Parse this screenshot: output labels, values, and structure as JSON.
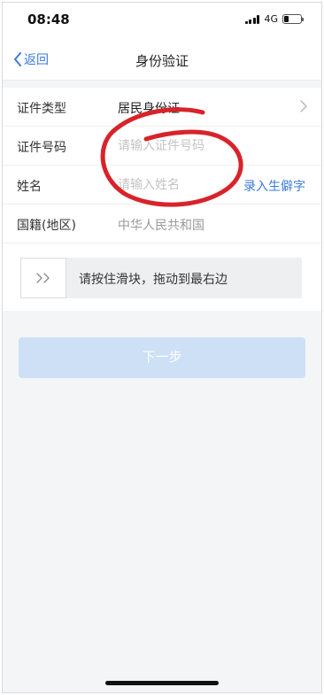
{
  "status_bar": {
    "time": "08:48",
    "network": "4G",
    "battery_level": 0.3
  },
  "nav": {
    "back_label": "返回",
    "title": "身份验证"
  },
  "form": {
    "rows": [
      {
        "label": "证件类型",
        "value": "居民身份证"
      },
      {
        "label": "证件号码",
        "placeholder": "请输入证件号码"
      },
      {
        "label": "姓名",
        "placeholder": "请输入姓名",
        "action": "录入生僻字"
      },
      {
        "label": "国籍(地区)",
        "value": "中华人民共和国"
      }
    ]
  },
  "slider": {
    "text": "请按住滑块，拖动到最右边"
  },
  "next_button": {
    "label": "下一步"
  },
  "colors": {
    "accent": "#3b7bd9",
    "disabled_button": "#cde0f6",
    "annotation": "#d8232a"
  }
}
